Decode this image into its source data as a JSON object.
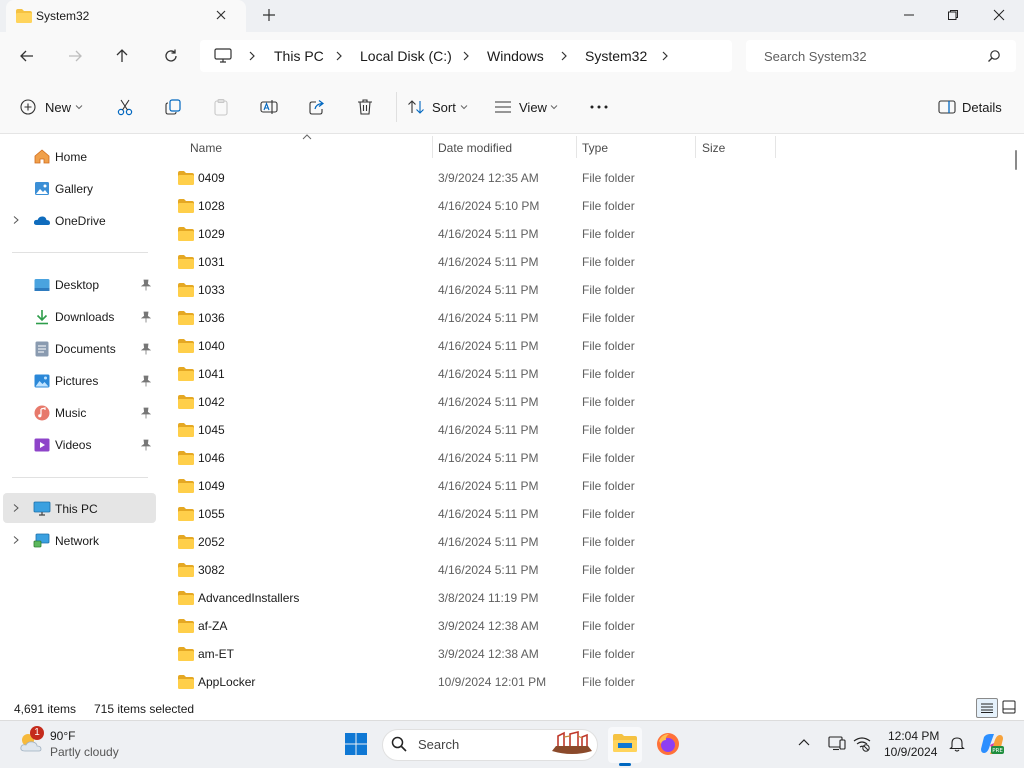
{
  "window": {
    "tab_title": "System32",
    "minimize": "minimize-icon",
    "maximize": "maximize-icon",
    "close": "close-icon"
  },
  "address": {
    "crumbs": [
      "This PC",
      "Local Disk (C:)",
      "Windows",
      "System32"
    ],
    "search_placeholder": "Search System32"
  },
  "toolbar": {
    "new_label": "New",
    "sort_label": "Sort",
    "view_label": "View",
    "details_label": "Details"
  },
  "sidebar": {
    "top": [
      {
        "label": "Home",
        "icon": "home-icon"
      },
      {
        "label": "Gallery",
        "icon": "gallery-icon"
      },
      {
        "label": "OneDrive",
        "icon": "onedrive-icon"
      }
    ],
    "pinned": [
      {
        "label": "Desktop",
        "icon": "desktop-icon"
      },
      {
        "label": "Downloads",
        "icon": "downloads-icon"
      },
      {
        "label": "Documents",
        "icon": "documents-icon"
      },
      {
        "label": "Pictures",
        "icon": "pictures-icon"
      },
      {
        "label": "Music",
        "icon": "music-icon"
      },
      {
        "label": "Videos",
        "icon": "videos-icon"
      }
    ],
    "bottom": [
      {
        "label": "This PC",
        "icon": "this-pc-icon",
        "selected": true
      },
      {
        "label": "Network",
        "icon": "network-icon"
      }
    ]
  },
  "columns": {
    "name": "Name",
    "date": "Date modified",
    "type": "Type",
    "size": "Size"
  },
  "files": [
    {
      "name": "0409",
      "date": "3/9/2024 12:35 AM",
      "type": "File folder"
    },
    {
      "name": "1028",
      "date": "4/16/2024 5:10 PM",
      "type": "File folder"
    },
    {
      "name": "1029",
      "date": "4/16/2024 5:11 PM",
      "type": "File folder"
    },
    {
      "name": "1031",
      "date": "4/16/2024 5:11 PM",
      "type": "File folder"
    },
    {
      "name": "1033",
      "date": "4/16/2024 5:11 PM",
      "type": "File folder"
    },
    {
      "name": "1036",
      "date": "4/16/2024 5:11 PM",
      "type": "File folder"
    },
    {
      "name": "1040",
      "date": "4/16/2024 5:11 PM",
      "type": "File folder"
    },
    {
      "name": "1041",
      "date": "4/16/2024 5:11 PM",
      "type": "File folder"
    },
    {
      "name": "1042",
      "date": "4/16/2024 5:11 PM",
      "type": "File folder"
    },
    {
      "name": "1045",
      "date": "4/16/2024 5:11 PM",
      "type": "File folder"
    },
    {
      "name": "1046",
      "date": "4/16/2024 5:11 PM",
      "type": "File folder"
    },
    {
      "name": "1049",
      "date": "4/16/2024 5:11 PM",
      "type": "File folder"
    },
    {
      "name": "1055",
      "date": "4/16/2024 5:11 PM",
      "type": "File folder"
    },
    {
      "name": "2052",
      "date": "4/16/2024 5:11 PM",
      "type": "File folder"
    },
    {
      "name": "3082",
      "date": "4/16/2024 5:11 PM",
      "type": "File folder"
    },
    {
      "name": "AdvancedInstallers",
      "date": "3/8/2024 11:19 PM",
      "type": "File folder"
    },
    {
      "name": "af-ZA",
      "date": "3/9/2024 12:38 AM",
      "type": "File folder"
    },
    {
      "name": "am-ET",
      "date": "3/9/2024 12:38 AM",
      "type": "File folder"
    },
    {
      "name": "AppLocker",
      "date": "10/9/2024 12:01 PM",
      "type": "File folder"
    }
  ],
  "status": {
    "item_count": "4,691 items",
    "selected": "715 items selected"
  },
  "taskbar": {
    "weather_temp": "90°F",
    "weather_desc": "Partly cloudy",
    "weather_badge": "1",
    "search_label": "Search",
    "time": "12:04 PM",
    "date": "10/9/2024"
  },
  "colors": {
    "folder": "#f5c242",
    "accent": "#0067c0",
    "selected_bg": "#e5e5e5"
  }
}
